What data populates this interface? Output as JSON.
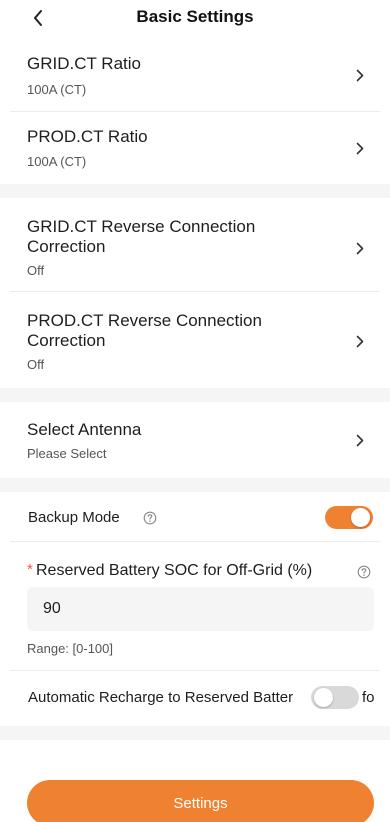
{
  "header": {
    "title": "Basic Settings"
  },
  "settings": [
    {
      "label": "GRID.CT Ratio",
      "value": "100A (CT)"
    },
    {
      "label": "PROD.CT Ratio",
      "value": "100A (CT)"
    },
    {
      "label_line1": "GRID.CT Reverse Connection",
      "label_line2": "Correction",
      "value": "Off"
    },
    {
      "label_line1": "PROD.CT Reverse Connection",
      "label_line2": "Correction",
      "value": "Off"
    },
    {
      "label": "Select Antenna",
      "value": "Please Select"
    }
  ],
  "backup_mode": {
    "label": "Backup Mode",
    "enabled": true
  },
  "reserved_soc": {
    "required_mark": "*",
    "label": "Reserved Battery SOC for Off-Grid (%)",
    "value": "90",
    "range": "Range: [0-100]"
  },
  "auto_recharge": {
    "label": "Automatic Recharge to Reserved Batter",
    "overflow_text": "fo",
    "enabled": false
  },
  "footer": {
    "button_label": "Settings"
  },
  "colors": {
    "accent": "#ef8230",
    "divider_band": "#f5f5f5",
    "toggle_off": "#d9d9d9"
  }
}
